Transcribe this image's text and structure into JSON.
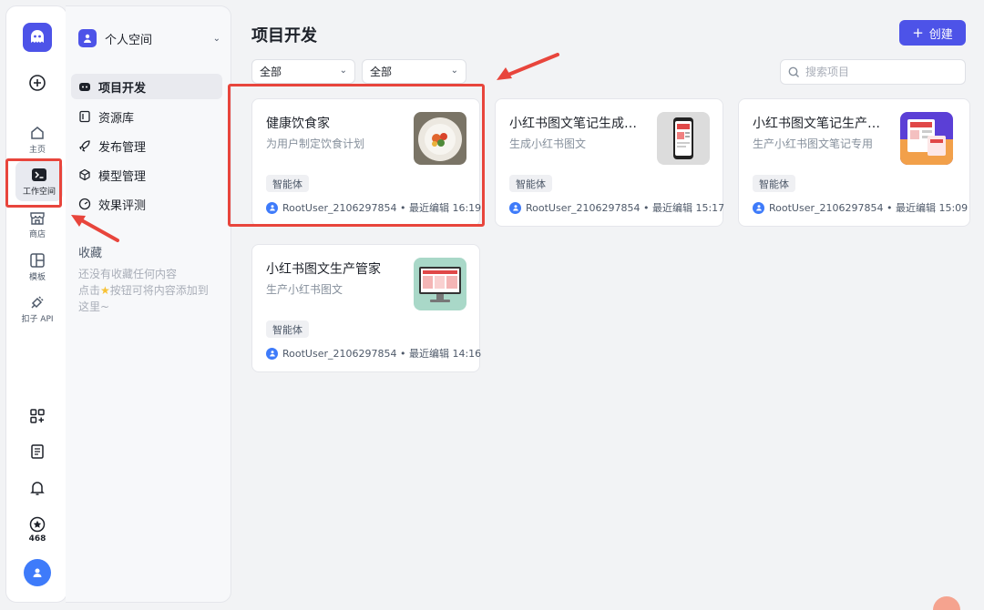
{
  "rail": {
    "items": [
      {
        "label": "主页"
      },
      {
        "label": "工作空间"
      },
      {
        "label": "商店"
      },
      {
        "label": "模板"
      },
      {
        "label": "扣子 API"
      }
    ],
    "star_count": "468"
  },
  "sidebar": {
    "workspace": "个人空间",
    "nav": [
      {
        "label": "项目开发",
        "icon": "bot-icon"
      },
      {
        "label": "资源库",
        "icon": "library-icon"
      },
      {
        "label": "发布管理",
        "icon": "rocket-icon"
      },
      {
        "label": "模型管理",
        "icon": "cube-icon"
      },
      {
        "label": "效果评测",
        "icon": "gauge-icon"
      }
    ],
    "favorites_title": "收藏",
    "favorites_empty_line1": "还没有收藏任何内容",
    "favorites_empty_line2_pre": "点击",
    "favorites_empty_line2_post": "按钮可将内容添加到",
    "favorites_empty_line3": "这里~"
  },
  "main": {
    "title": "项目开发",
    "create_label": "创建",
    "filter1": "全部",
    "filter2": "全部",
    "search_placeholder": "搜索项目",
    "cards": [
      {
        "title": "健康饮食家",
        "desc": "为用户制定饮食计划",
        "tag": "智能体",
        "user": "RootUser_2106297854",
        "edited": "最近编辑 16:19"
      },
      {
        "title": "小红书图文笔记生成…",
        "desc": "生成小红书图文",
        "tag": "智能体",
        "user": "RootUser_2106297854",
        "edited": "最近编辑 15:17"
      },
      {
        "title": "小红书图文笔记生产…",
        "desc": "生产小红书图文笔记专用",
        "tag": "智能体",
        "user": "RootUser_2106297854",
        "edited": "最近编辑 15:09"
      },
      {
        "title": "小红书图文生产管家",
        "desc": "生产小红书图文",
        "tag": "智能体",
        "user": "RootUser_2106297854",
        "edited": "最近编辑 14:16"
      }
    ]
  },
  "colors": {
    "accent": "#4d53e8",
    "annotation": "#e8453c"
  }
}
